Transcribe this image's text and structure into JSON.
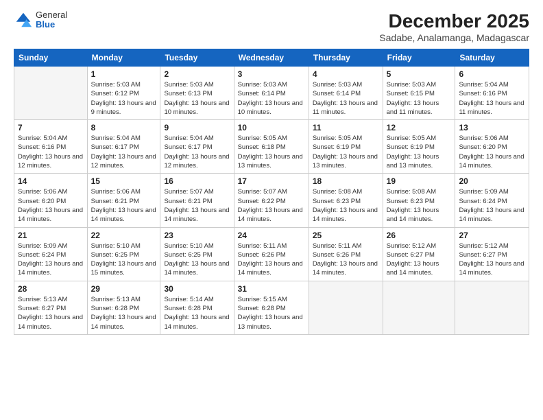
{
  "logo": {
    "general": "General",
    "blue": "Blue"
  },
  "title": {
    "month_year": "December 2025",
    "location": "Sadabe, Analamanga, Madagascar"
  },
  "weekdays": [
    "Sunday",
    "Monday",
    "Tuesday",
    "Wednesday",
    "Thursday",
    "Friday",
    "Saturday"
  ],
  "weeks": [
    [
      {
        "day": "",
        "empty": true
      },
      {
        "day": "1",
        "sunrise": "Sunrise: 5:03 AM",
        "sunset": "Sunset: 6:12 PM",
        "daylight": "Daylight: 13 hours and 9 minutes."
      },
      {
        "day": "2",
        "sunrise": "Sunrise: 5:03 AM",
        "sunset": "Sunset: 6:13 PM",
        "daylight": "Daylight: 13 hours and 10 minutes."
      },
      {
        "day": "3",
        "sunrise": "Sunrise: 5:03 AM",
        "sunset": "Sunset: 6:14 PM",
        "daylight": "Daylight: 13 hours and 10 minutes."
      },
      {
        "day": "4",
        "sunrise": "Sunrise: 5:03 AM",
        "sunset": "Sunset: 6:14 PM",
        "daylight": "Daylight: 13 hours and 11 minutes."
      },
      {
        "day": "5",
        "sunrise": "Sunrise: 5:03 AM",
        "sunset": "Sunset: 6:15 PM",
        "daylight": "Daylight: 13 hours and 11 minutes."
      },
      {
        "day": "6",
        "sunrise": "Sunrise: 5:04 AM",
        "sunset": "Sunset: 6:16 PM",
        "daylight": "Daylight: 13 hours and 11 minutes."
      }
    ],
    [
      {
        "day": "7",
        "sunrise": "Sunrise: 5:04 AM",
        "sunset": "Sunset: 6:16 PM",
        "daylight": "Daylight: 13 hours and 12 minutes."
      },
      {
        "day": "8",
        "sunrise": "Sunrise: 5:04 AM",
        "sunset": "Sunset: 6:17 PM",
        "daylight": "Daylight: 13 hours and 12 minutes."
      },
      {
        "day": "9",
        "sunrise": "Sunrise: 5:04 AM",
        "sunset": "Sunset: 6:17 PM",
        "daylight": "Daylight: 13 hours and 12 minutes."
      },
      {
        "day": "10",
        "sunrise": "Sunrise: 5:05 AM",
        "sunset": "Sunset: 6:18 PM",
        "daylight": "Daylight: 13 hours and 13 minutes."
      },
      {
        "day": "11",
        "sunrise": "Sunrise: 5:05 AM",
        "sunset": "Sunset: 6:19 PM",
        "daylight": "Daylight: 13 hours and 13 minutes."
      },
      {
        "day": "12",
        "sunrise": "Sunrise: 5:05 AM",
        "sunset": "Sunset: 6:19 PM",
        "daylight": "Daylight: 13 hours and 13 minutes."
      },
      {
        "day": "13",
        "sunrise": "Sunrise: 5:06 AM",
        "sunset": "Sunset: 6:20 PM",
        "daylight": "Daylight: 13 hours and 14 minutes."
      }
    ],
    [
      {
        "day": "14",
        "sunrise": "Sunrise: 5:06 AM",
        "sunset": "Sunset: 6:20 PM",
        "daylight": "Daylight: 13 hours and 14 minutes."
      },
      {
        "day": "15",
        "sunrise": "Sunrise: 5:06 AM",
        "sunset": "Sunset: 6:21 PM",
        "daylight": "Daylight: 13 hours and 14 minutes."
      },
      {
        "day": "16",
        "sunrise": "Sunrise: 5:07 AM",
        "sunset": "Sunset: 6:21 PM",
        "daylight": "Daylight: 13 hours and 14 minutes."
      },
      {
        "day": "17",
        "sunrise": "Sunrise: 5:07 AM",
        "sunset": "Sunset: 6:22 PM",
        "daylight": "Daylight: 13 hours and 14 minutes."
      },
      {
        "day": "18",
        "sunrise": "Sunrise: 5:08 AM",
        "sunset": "Sunset: 6:23 PM",
        "daylight": "Daylight: 13 hours and 14 minutes."
      },
      {
        "day": "19",
        "sunrise": "Sunrise: 5:08 AM",
        "sunset": "Sunset: 6:23 PM",
        "daylight": "Daylight: 13 hours and 14 minutes."
      },
      {
        "day": "20",
        "sunrise": "Sunrise: 5:09 AM",
        "sunset": "Sunset: 6:24 PM",
        "daylight": "Daylight: 13 hours and 14 minutes."
      }
    ],
    [
      {
        "day": "21",
        "sunrise": "Sunrise: 5:09 AM",
        "sunset": "Sunset: 6:24 PM",
        "daylight": "Daylight: 13 hours and 14 minutes."
      },
      {
        "day": "22",
        "sunrise": "Sunrise: 5:10 AM",
        "sunset": "Sunset: 6:25 PM",
        "daylight": "Daylight: 13 hours and 15 minutes."
      },
      {
        "day": "23",
        "sunrise": "Sunrise: 5:10 AM",
        "sunset": "Sunset: 6:25 PM",
        "daylight": "Daylight: 13 hours and 14 minutes."
      },
      {
        "day": "24",
        "sunrise": "Sunrise: 5:11 AM",
        "sunset": "Sunset: 6:26 PM",
        "daylight": "Daylight: 13 hours and 14 minutes."
      },
      {
        "day": "25",
        "sunrise": "Sunrise: 5:11 AM",
        "sunset": "Sunset: 6:26 PM",
        "daylight": "Daylight: 13 hours and 14 minutes."
      },
      {
        "day": "26",
        "sunrise": "Sunrise: 5:12 AM",
        "sunset": "Sunset: 6:27 PM",
        "daylight": "Daylight: 13 hours and 14 minutes."
      },
      {
        "day": "27",
        "sunrise": "Sunrise: 5:12 AM",
        "sunset": "Sunset: 6:27 PM",
        "daylight": "Daylight: 13 hours and 14 minutes."
      }
    ],
    [
      {
        "day": "28",
        "sunrise": "Sunrise: 5:13 AM",
        "sunset": "Sunset: 6:27 PM",
        "daylight": "Daylight: 13 hours and 14 minutes."
      },
      {
        "day": "29",
        "sunrise": "Sunrise: 5:13 AM",
        "sunset": "Sunset: 6:28 PM",
        "daylight": "Daylight: 13 hours and 14 minutes."
      },
      {
        "day": "30",
        "sunrise": "Sunrise: 5:14 AM",
        "sunset": "Sunset: 6:28 PM",
        "daylight": "Daylight: 13 hours and 14 minutes."
      },
      {
        "day": "31",
        "sunrise": "Sunrise: 5:15 AM",
        "sunset": "Sunset: 6:28 PM",
        "daylight": "Daylight: 13 hours and 13 minutes."
      },
      {
        "day": "",
        "empty": true
      },
      {
        "day": "",
        "empty": true
      },
      {
        "day": "",
        "empty": true
      }
    ]
  ]
}
